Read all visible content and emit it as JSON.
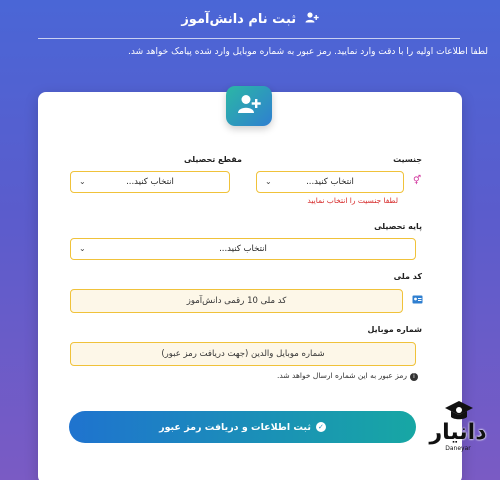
{
  "header": {
    "title": "ثبت نام دانش‌آموز",
    "title_icon": "user-plus-icon",
    "subtitle": "لطفا اطلاعات اولیه را با دقت وارد نمایید. رمز عبور به شماره موبایل وارد شده پیامک خواهد شد."
  },
  "form": {
    "avatar_icon": "user-plus-icon",
    "gender": {
      "label": "جنسیت",
      "value": "انتخاب کنید...",
      "icon": "gender-icon",
      "error": "لطفا جنسیت را انتخاب نمایید"
    },
    "education_level": {
      "label": "مقطع تحصیلی",
      "value": "انتخاب کنید..."
    },
    "grade": {
      "label": "پایه تحصیلی",
      "value": "انتخاب کنید..."
    },
    "national_code": {
      "label": "کد ملی",
      "placeholder": "کد ملی 10 رقمی دانش‌آموز",
      "icon": "id-card-icon"
    },
    "mobile": {
      "label": "شماره موبایل",
      "placeholder": "شماره موبایل والدین (جهت دریافت رمز عبور)",
      "hint": "رمز عبور به این شماره ارسال خواهد شد."
    },
    "submit_label": "ثبت اطلاعات و دریافت رمز عبور"
  },
  "watermark": {
    "word": "دانیار",
    "latin": "Daneyar"
  },
  "colors": {
    "accent": "#f0c23a",
    "error": "#d62b2b",
    "button_start": "#1f73cf",
    "button_end": "#17a7a4"
  }
}
